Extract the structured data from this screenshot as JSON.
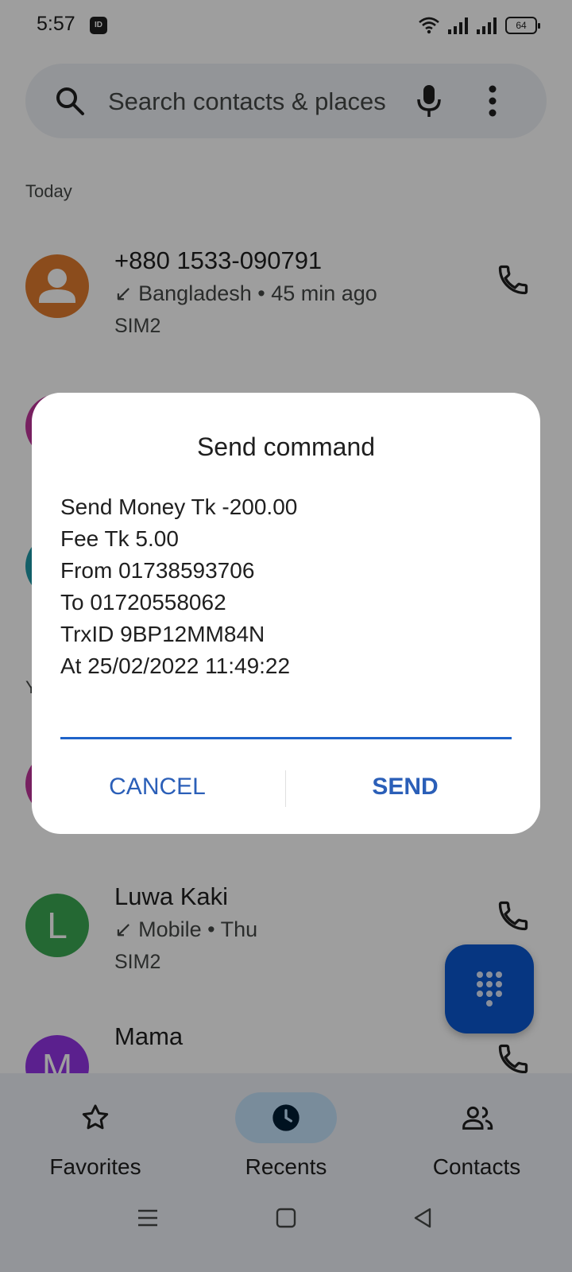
{
  "status_bar": {
    "time": "5:57",
    "id_badge": "ID",
    "battery": "64"
  },
  "search": {
    "placeholder": "Search contacts & places"
  },
  "sections": {
    "today": "Today",
    "yesterday_partial": "Y"
  },
  "calls": [
    {
      "title": "+880 1533-090791",
      "arrow": "↙",
      "detail": "Bangladesh • 45 min ago",
      "sim": "SIM2",
      "avatar_color": "#e07b2e"
    },
    {
      "avatar_color": "#c0359b"
    },
    {
      "avatar_color": "#1f9aa8"
    },
    {
      "avatar_color": "#c0359b"
    },
    {
      "title": "Luwa Kaki",
      "initial": "L",
      "arrow": "↙",
      "detail": "Mobile • Thu",
      "sim": "SIM2",
      "avatar_color": "#3aa853"
    },
    {
      "title": "Mama",
      "initial": "M",
      "avatar_color": "#9334e6"
    }
  ],
  "bottom_nav": {
    "favorites": "Favorites",
    "recents": "Recents",
    "contacts": "Contacts"
  },
  "dialog": {
    "title": "Send command",
    "lines": [
      "Send Money Tk -200.00",
      "Fee Tk 5.00",
      "From 01738593706",
      "To 01720558062",
      "TrxID 9BP12MM84N",
      "At 25/02/2022 11:49:22"
    ],
    "input_value": "",
    "cancel": "CANCEL",
    "send": "SEND"
  },
  "colors": {
    "accent": "#0b57d0",
    "dialog_button": "#2b5fb8",
    "input_underline": "#1f63c9"
  }
}
